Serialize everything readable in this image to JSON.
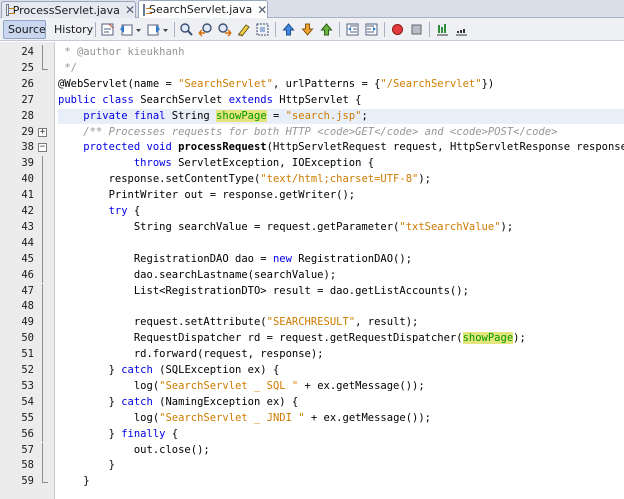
{
  "tabs": [
    {
      "label": "ProcessServlet.java",
      "active": false,
      "icon": "java-file-icon"
    },
    {
      "label": "SearchServlet.java",
      "active": true,
      "icon": "java-file-icon"
    }
  ],
  "toolbar": {
    "source_label": "Source",
    "history_label": "History",
    "icons": [
      "last-edit-icon",
      "back-icon",
      "back-dropdown-icon",
      "forward-icon",
      "forward-dropdown-icon",
      "find-selection-icon",
      "find-previous-icon",
      "find-next-icon",
      "toggle-highlight-icon",
      "toggle-rectangular-select-icon",
      "previous-bookmark-icon",
      "next-bookmark-icon",
      "toggle-bookmark-icon",
      "shift-left-icon",
      "shift-right-icon",
      "start-macro-icon",
      "stop-macro-icon",
      "comment-icon",
      "uncomment-icon"
    ]
  },
  "editor": {
    "lines": [
      {
        "num": "24",
        "fold": "line",
        "tokens": [
          {
            "t": " * @author kieukhanh",
            "c": "cm"
          }
        ]
      },
      {
        "num": "25",
        "fold": "end",
        "tokens": [
          {
            "t": " */",
            "c": "cm"
          }
        ]
      },
      {
        "num": "26",
        "tokens": [
          {
            "t": "@WebServlet(name = ",
            "c": "ann"
          },
          {
            "t": "\"SearchServlet\"",
            "c": "str"
          },
          {
            "t": ", urlPatterns = {",
            "c": ""
          },
          {
            "t": "\"/SearchServlet\"",
            "c": "str"
          },
          {
            "t": "})",
            "c": ""
          }
        ]
      },
      {
        "num": "27",
        "tokens": [
          {
            "t": "public class ",
            "c": "kw"
          },
          {
            "t": "SearchServlet ",
            "c": ""
          },
          {
            "t": "extends ",
            "c": "kw"
          },
          {
            "t": "HttpServlet {",
            "c": ""
          }
        ]
      },
      {
        "num": "28",
        "hl": true,
        "tokens": [
          {
            "t": "    private final ",
            "c": "kw"
          },
          {
            "t": "String ",
            "c": ""
          },
          {
            "t": "showPage",
            "c": "mark"
          },
          {
            "t": " = ",
            "c": ""
          },
          {
            "t": "\"search.jsp\"",
            "c": "str"
          },
          {
            "t": ";",
            "c": ""
          }
        ]
      },
      {
        "num": "29",
        "fold": "plus",
        "tokens": [
          {
            "t": "    /** Processes requests for both HTTP <code>GET</code> and <code>POST</code>",
            "c": "cm-i"
          }
        ]
      },
      {
        "num": "38",
        "fold": "minus",
        "tokens": [
          {
            "t": "    protected void ",
            "c": "kw"
          },
          {
            "t": "processRequest",
            "c": "bold"
          },
          {
            "t": "(HttpServletRequest request, HttpServletResponse response)",
            "c": ""
          }
        ]
      },
      {
        "num": "39",
        "fold": "line",
        "tokens": [
          {
            "t": "            throws ",
            "c": "kw"
          },
          {
            "t": "ServletException, IOException {",
            "c": ""
          }
        ]
      },
      {
        "num": "40",
        "fold": "line",
        "tokens": [
          {
            "t": "        response.setContentType(",
            "c": ""
          },
          {
            "t": "\"text/html;charset=UTF-8\"",
            "c": "str"
          },
          {
            "t": ");",
            "c": ""
          }
        ]
      },
      {
        "num": "41",
        "fold": "line",
        "tokens": [
          {
            "t": "        PrintWriter out = response.getWriter();",
            "c": ""
          }
        ]
      },
      {
        "num": "42",
        "fold": "line",
        "tokens": [
          {
            "t": "        try ",
            "c": "kw"
          },
          {
            "t": "{",
            "c": ""
          }
        ]
      },
      {
        "num": "43",
        "fold": "line",
        "tokens": [
          {
            "t": "            String searchValue = request.getParameter(",
            "c": ""
          },
          {
            "t": "\"txtSearchValue\"",
            "c": "str"
          },
          {
            "t": ");",
            "c": ""
          }
        ]
      },
      {
        "num": "44",
        "fold": "line",
        "tokens": []
      },
      {
        "num": "45",
        "fold": "line",
        "tokens": [
          {
            "t": "            RegistrationDAO dao = ",
            "c": ""
          },
          {
            "t": "new ",
            "c": "kw"
          },
          {
            "t": "RegistrationDAO();",
            "c": ""
          }
        ]
      },
      {
        "num": "46",
        "fold": "line",
        "tokens": [
          {
            "t": "            dao.searchLastname(searchValue);",
            "c": ""
          }
        ]
      },
      {
        "num": "47",
        "fold": "line",
        "tokens": [
          {
            "t": "            List<RegistrationDTO> result = dao.getListAccounts();",
            "c": ""
          }
        ]
      },
      {
        "num": "48",
        "fold": "line",
        "tokens": []
      },
      {
        "num": "49",
        "fold": "line",
        "tokens": [
          {
            "t": "            request.setAttribute(",
            "c": ""
          },
          {
            "t": "\"SEARCHRESULT\"",
            "c": "str"
          },
          {
            "t": ", result);",
            "c": ""
          }
        ]
      },
      {
        "num": "50",
        "fold": "line",
        "tokens": [
          {
            "t": "            RequestDispatcher rd = request.getRequestDispatcher(",
            "c": ""
          },
          {
            "t": "showPage",
            "c": "mark"
          },
          {
            "t": ");",
            "c": ""
          }
        ]
      },
      {
        "num": "51",
        "fold": "line",
        "tokens": [
          {
            "t": "            rd.forward(request, response);",
            "c": ""
          }
        ]
      },
      {
        "num": "52",
        "fold": "line",
        "tokens": [
          {
            "t": "        } ",
            "c": ""
          },
          {
            "t": "catch ",
            "c": "kw"
          },
          {
            "t": "(SQLException ex) {",
            "c": ""
          }
        ]
      },
      {
        "num": "53",
        "fold": "line",
        "tokens": [
          {
            "t": "            log(",
            "c": ""
          },
          {
            "t": "\"SearchServlet _ SQL \"",
            "c": "str"
          },
          {
            "t": " + ex.getMessage());",
            "c": ""
          }
        ]
      },
      {
        "num": "54",
        "fold": "line",
        "tokens": [
          {
            "t": "        } ",
            "c": ""
          },
          {
            "t": "catch ",
            "c": "kw"
          },
          {
            "t": "(NamingException ex) {",
            "c": ""
          }
        ]
      },
      {
        "num": "55",
        "fold": "line",
        "tokens": [
          {
            "t": "            log(",
            "c": ""
          },
          {
            "t": "\"SearchServlet _ JNDI \"",
            "c": "str"
          },
          {
            "t": " + ex.getMessage());",
            "c": ""
          }
        ]
      },
      {
        "num": "56",
        "fold": "line",
        "tokens": [
          {
            "t": "        } ",
            "c": ""
          },
          {
            "t": "finally ",
            "c": "kw"
          },
          {
            "t": "{",
            "c": ""
          }
        ]
      },
      {
        "num": "57",
        "fold": "line",
        "tokens": [
          {
            "t": "            out.close();",
            "c": ""
          }
        ]
      },
      {
        "num": "58",
        "fold": "line",
        "tokens": [
          {
            "t": "        }",
            "c": ""
          }
        ]
      },
      {
        "num": "59",
        "fold": "end",
        "tokens": [
          {
            "t": "    }",
            "c": ""
          }
        ]
      }
    ]
  },
  "colors": {
    "keyword": "#0000e6",
    "string": "#ce7b00",
    "comment": "#969696",
    "field": "#009900",
    "mark_bg": "#e4e47c"
  }
}
